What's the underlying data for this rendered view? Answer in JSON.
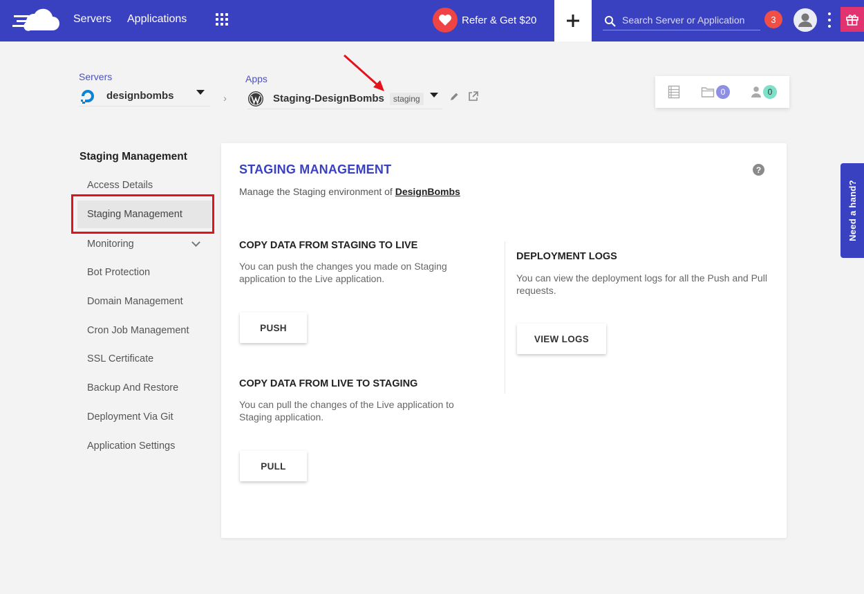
{
  "topbar": {
    "nav_servers": "Servers",
    "nav_applications": "Applications",
    "refer_label": "Refer & Get $20",
    "search_placeholder": "Search Server or Application",
    "notification_count": "3"
  },
  "breadcrumb": {
    "servers_label": "Servers",
    "server_name": "designbombs",
    "apps_label": "Apps",
    "app_name": "Staging-DesignBombs",
    "app_tag": "staging"
  },
  "stats": {
    "folders_count": "0",
    "users_count": "0"
  },
  "sidebar": {
    "title": "Staging Management",
    "items": [
      {
        "label": "Access Details"
      },
      {
        "label": "Staging Management"
      },
      {
        "label": "Monitoring"
      },
      {
        "label": "Bot Protection"
      },
      {
        "label": "Domain Management"
      },
      {
        "label": "Cron Job Management"
      },
      {
        "label": "SSL Certificate"
      },
      {
        "label": "Backup And Restore"
      },
      {
        "label": "Deployment Via Git"
      },
      {
        "label": "Application Settings"
      }
    ]
  },
  "main": {
    "title": "STAGING MANAGEMENT",
    "subtitle_prefix": "Manage the Staging environment of ",
    "subtitle_link": "DesignBombs",
    "help_symbol": "?",
    "push_section": {
      "title": "COPY DATA FROM STAGING TO LIVE",
      "description": "You can push the changes you made on Staging application to the Live application.",
      "button": "PUSH"
    },
    "pull_section": {
      "title": "COPY DATA FROM LIVE TO STAGING",
      "description": "You can pull the changes of the Live application to Staging application.",
      "button": "PULL"
    },
    "logs_section": {
      "title": "DEPLOYMENT LOGS",
      "description": "You can view the deployment logs for all the Push and Pull requests.",
      "button": "VIEW LOGS"
    }
  },
  "help_tab": {
    "label": "Need a hand?"
  },
  "colors": {
    "brand": "#3a41c0",
    "notification": "#ef4f46",
    "highlight": "#e3131b",
    "gift": "#e0336f"
  }
}
